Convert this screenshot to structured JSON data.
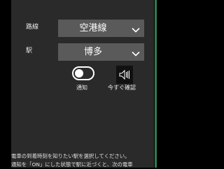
{
  "colors": {
    "background": "#000000",
    "panel": "#2a2a2a",
    "select": "#5a5a5a",
    "accent_bar": "#2e7d4f",
    "text": "#ffffff"
  },
  "route": {
    "label": "路線",
    "value": "空港線",
    "icon": "chevron-down-icon"
  },
  "station": {
    "label": "駅",
    "value": "博多",
    "icon": "chevron-down-icon"
  },
  "notify": {
    "label": "通知",
    "state": "off"
  },
  "check_now": {
    "label": "今すぐ確認",
    "icon": "speaker-icon"
  },
  "description": {
    "line1": "電車の到着時刻を知りたい駅を選択してください。",
    "line2": "通知を「ON」にした状態で駅に近づくと、次の電車"
  }
}
